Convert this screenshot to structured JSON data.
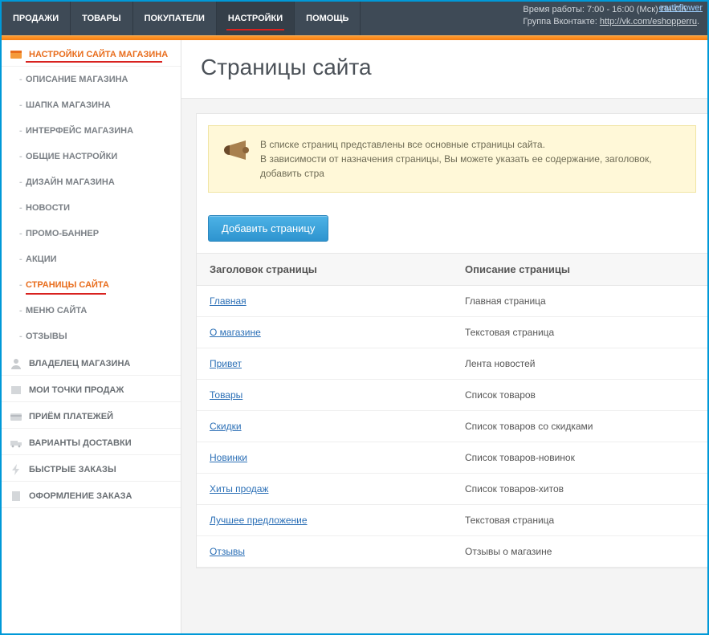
{
  "topnav": {
    "items": [
      {
        "label": "ПРОДАЖИ"
      },
      {
        "label": "ТОВАРЫ"
      },
      {
        "label": "ПОКУПАТЕЛИ"
      },
      {
        "label": "НАСТРОЙКИ"
      },
      {
        "label": "ПОМОЩЬ"
      }
    ],
    "work_hours": "Время работы: 7:00 - 16:00 (Мск) Пн-Сб.",
    "vk_label": "Группа Вконтакте:",
    "vk_link": "http://vk.com/eshopperru",
    "user_link": "earthflower"
  },
  "sidebar": {
    "section_settings": "НАСТРОЙКИ САЙТА МАГАЗИНА",
    "subs": [
      {
        "label": "ОПИСАНИЕ МАГАЗИНА"
      },
      {
        "label": "ШАПКА МАГАЗИНА"
      },
      {
        "label": "ИНТЕРФЕЙС МАГАЗИНА"
      },
      {
        "label": "ОБЩИЕ НАСТРОЙКИ"
      },
      {
        "label": "ДИЗАЙН МАГАЗИНА"
      },
      {
        "label": "НОВОСТИ"
      },
      {
        "label": "ПРОМО-БАННЕР"
      },
      {
        "label": "АКЦИИ"
      },
      {
        "label": "СТРАНИЦЫ САЙТА"
      },
      {
        "label": "МЕНЮ САЙТА"
      },
      {
        "label": "ОТЗЫВЫ"
      }
    ],
    "sections": [
      {
        "label": "ВЛАДЕЛЕЦ МАГАЗИНА"
      },
      {
        "label": "МОИ ТОЧКИ ПРОДАЖ"
      },
      {
        "label": "ПРИЁМ ПЛАТЕЖЕЙ"
      },
      {
        "label": "ВАРИАНТЫ ДОСТАВКИ"
      },
      {
        "label": "БЫСТРЫЕ ЗАКАЗЫ"
      },
      {
        "label": "ОФОРМЛЕНИЕ ЗАКАЗА"
      }
    ]
  },
  "main": {
    "title": "Страницы сайта",
    "info_line1": "В списке страниц представлены все основные страницы сайта.",
    "info_line2": "В зависимости от назначения страницы, Вы можете указать ее содержание, заголовок, добавить стра",
    "add_button": "Добавить страницу",
    "table": {
      "col_title": "Заголовок страницы",
      "col_desc": "Описание страницы",
      "rows": [
        {
          "title": "Главная",
          "desc": "Главная страница"
        },
        {
          "title": "О магазине",
          "desc": "Текстовая страница"
        },
        {
          "title": "Привет",
          "desc": "Лента новостей"
        },
        {
          "title": "Товары",
          "desc": "Список товаров"
        },
        {
          "title": "Скидки",
          "desc": "Список товаров со скидками"
        },
        {
          "title": "Новинки",
          "desc": "Список товаров-новинок"
        },
        {
          "title": "Хиты продаж",
          "desc": "Список товаров-хитов"
        },
        {
          "title": "Лучшее предложение",
          "desc": "Текстовая страница"
        },
        {
          "title": "Отзывы",
          "desc": "Отзывы о магазине"
        }
      ]
    }
  }
}
